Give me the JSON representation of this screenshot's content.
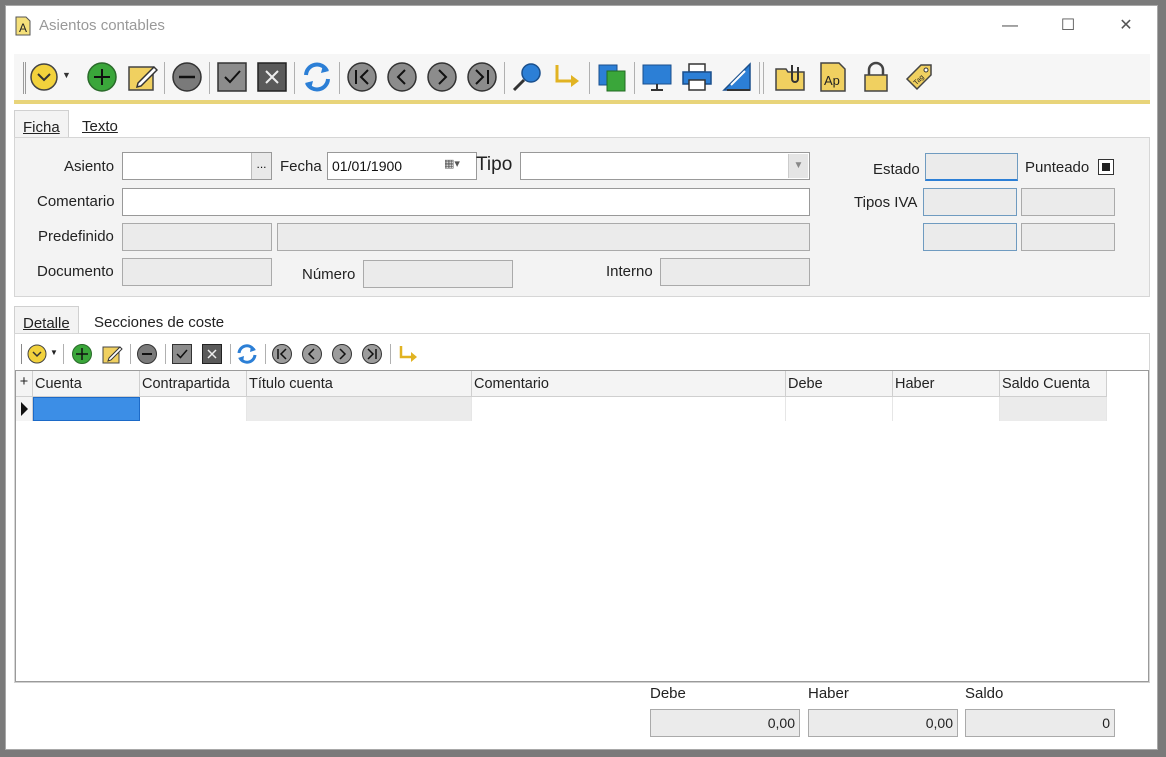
{
  "window": {
    "title": "Asientos contables",
    "controls": {
      "minimize": "—",
      "maximize": "☐",
      "close": "✕"
    }
  },
  "toolbar": {
    "icons": [
      "dropdown-menu-icon",
      "add-icon",
      "edit-icon",
      "delete-icon",
      "confirm-icon",
      "cancel-icon",
      "refresh-icon",
      "first-icon",
      "previous-icon",
      "next-icon",
      "last-icon",
      "search-icon",
      "jump-icon",
      "copy-icon",
      "screen-icon",
      "print-icon",
      "design-icon",
      "attach-icon",
      "ap-icon",
      "lock-icon",
      "tag-icon"
    ],
    "colors": {
      "accent": "#e8d47a",
      "green": "#3aa63a",
      "yellow": "#f0d060",
      "blue": "#2c7fd6"
    }
  },
  "tabs_top": [
    {
      "label": "Ficha",
      "active": true
    },
    {
      "label": "Texto",
      "active": false
    }
  ],
  "form": {
    "asiento_label": "Asiento",
    "asiento_value": "",
    "asiento_btn": "...",
    "fecha_label": "Fecha",
    "fecha_value": "01/01/1900",
    "tipo_label": "Tipo",
    "tipo_value": "",
    "estado_label": "Estado",
    "estado_value": "",
    "punteado_label": "Punteado",
    "punteado_checked": true,
    "comentario_label": "Comentario",
    "comentario_value": "",
    "tipos_iva_label": "Tipos IVA",
    "predefinido_label": "Predefinido",
    "documento_label": "Documento",
    "numero_label": "Número",
    "interno_label": "Interno"
  },
  "tabs_detail": [
    {
      "label": "Detalle",
      "active": true
    },
    {
      "label": "Secciones de coste",
      "active": false
    }
  ],
  "grid": {
    "add_col": "+",
    "columns": [
      "Cuenta",
      "Contrapartida",
      "Título cuenta",
      "Comentario",
      "Debe",
      "Haber",
      "Saldo Cuenta"
    ],
    "rows": [
      [
        "",
        "",
        "",
        "",
        "",
        "",
        ""
      ]
    ]
  },
  "totals": {
    "debe_label": "Debe",
    "debe_value": "0,00",
    "haber_label": "Haber",
    "haber_value": "0,00",
    "saldo_label": "Saldo",
    "saldo_value": "0"
  }
}
